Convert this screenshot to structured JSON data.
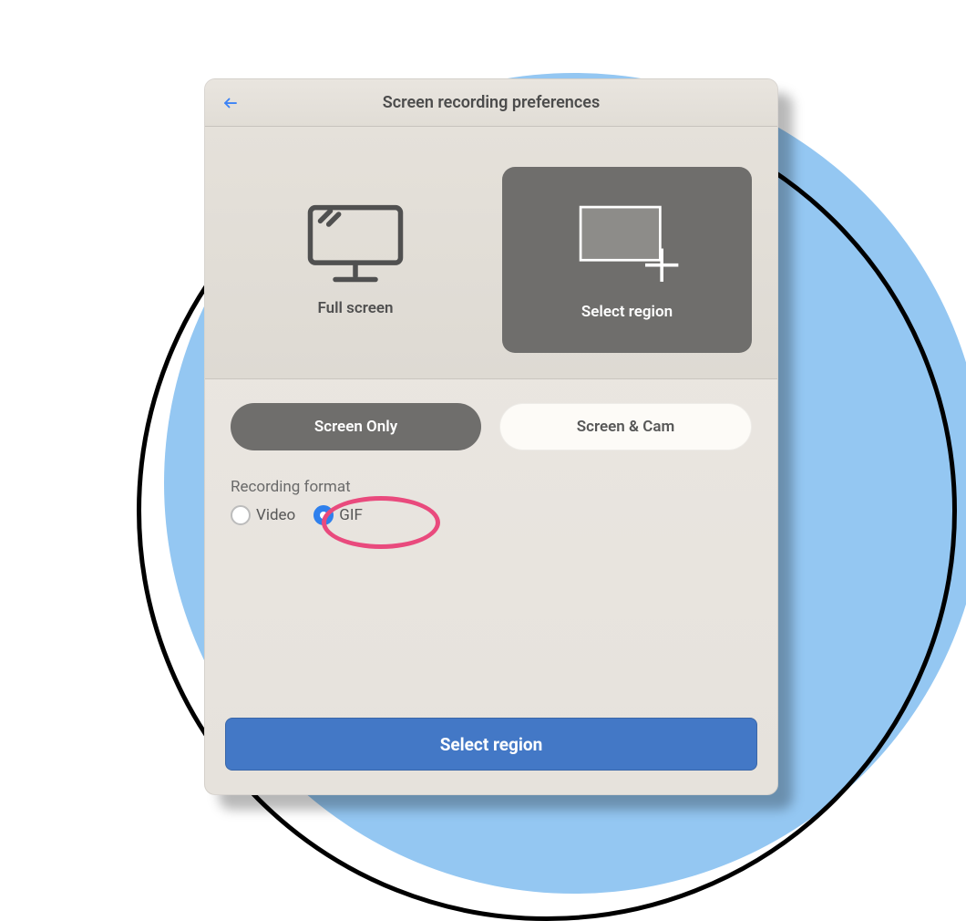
{
  "header": {
    "title": "Screen recording preferences"
  },
  "modes": {
    "fullscreen_label": "Full screen",
    "selectregion_label": "Select region",
    "selected": "select_region"
  },
  "inputs": {
    "screen_only_label": "Screen Only",
    "screen_and_cam_label": "Screen & Cam",
    "selected": "screen_only"
  },
  "format": {
    "section_label": "Recording format",
    "video_label": "Video",
    "gif_label": "GIF",
    "selected": "gif"
  },
  "primary_button_label": "Select region",
  "annotation": {
    "highlight_target": "format-gif-radio",
    "color": "#E94A7D"
  }
}
